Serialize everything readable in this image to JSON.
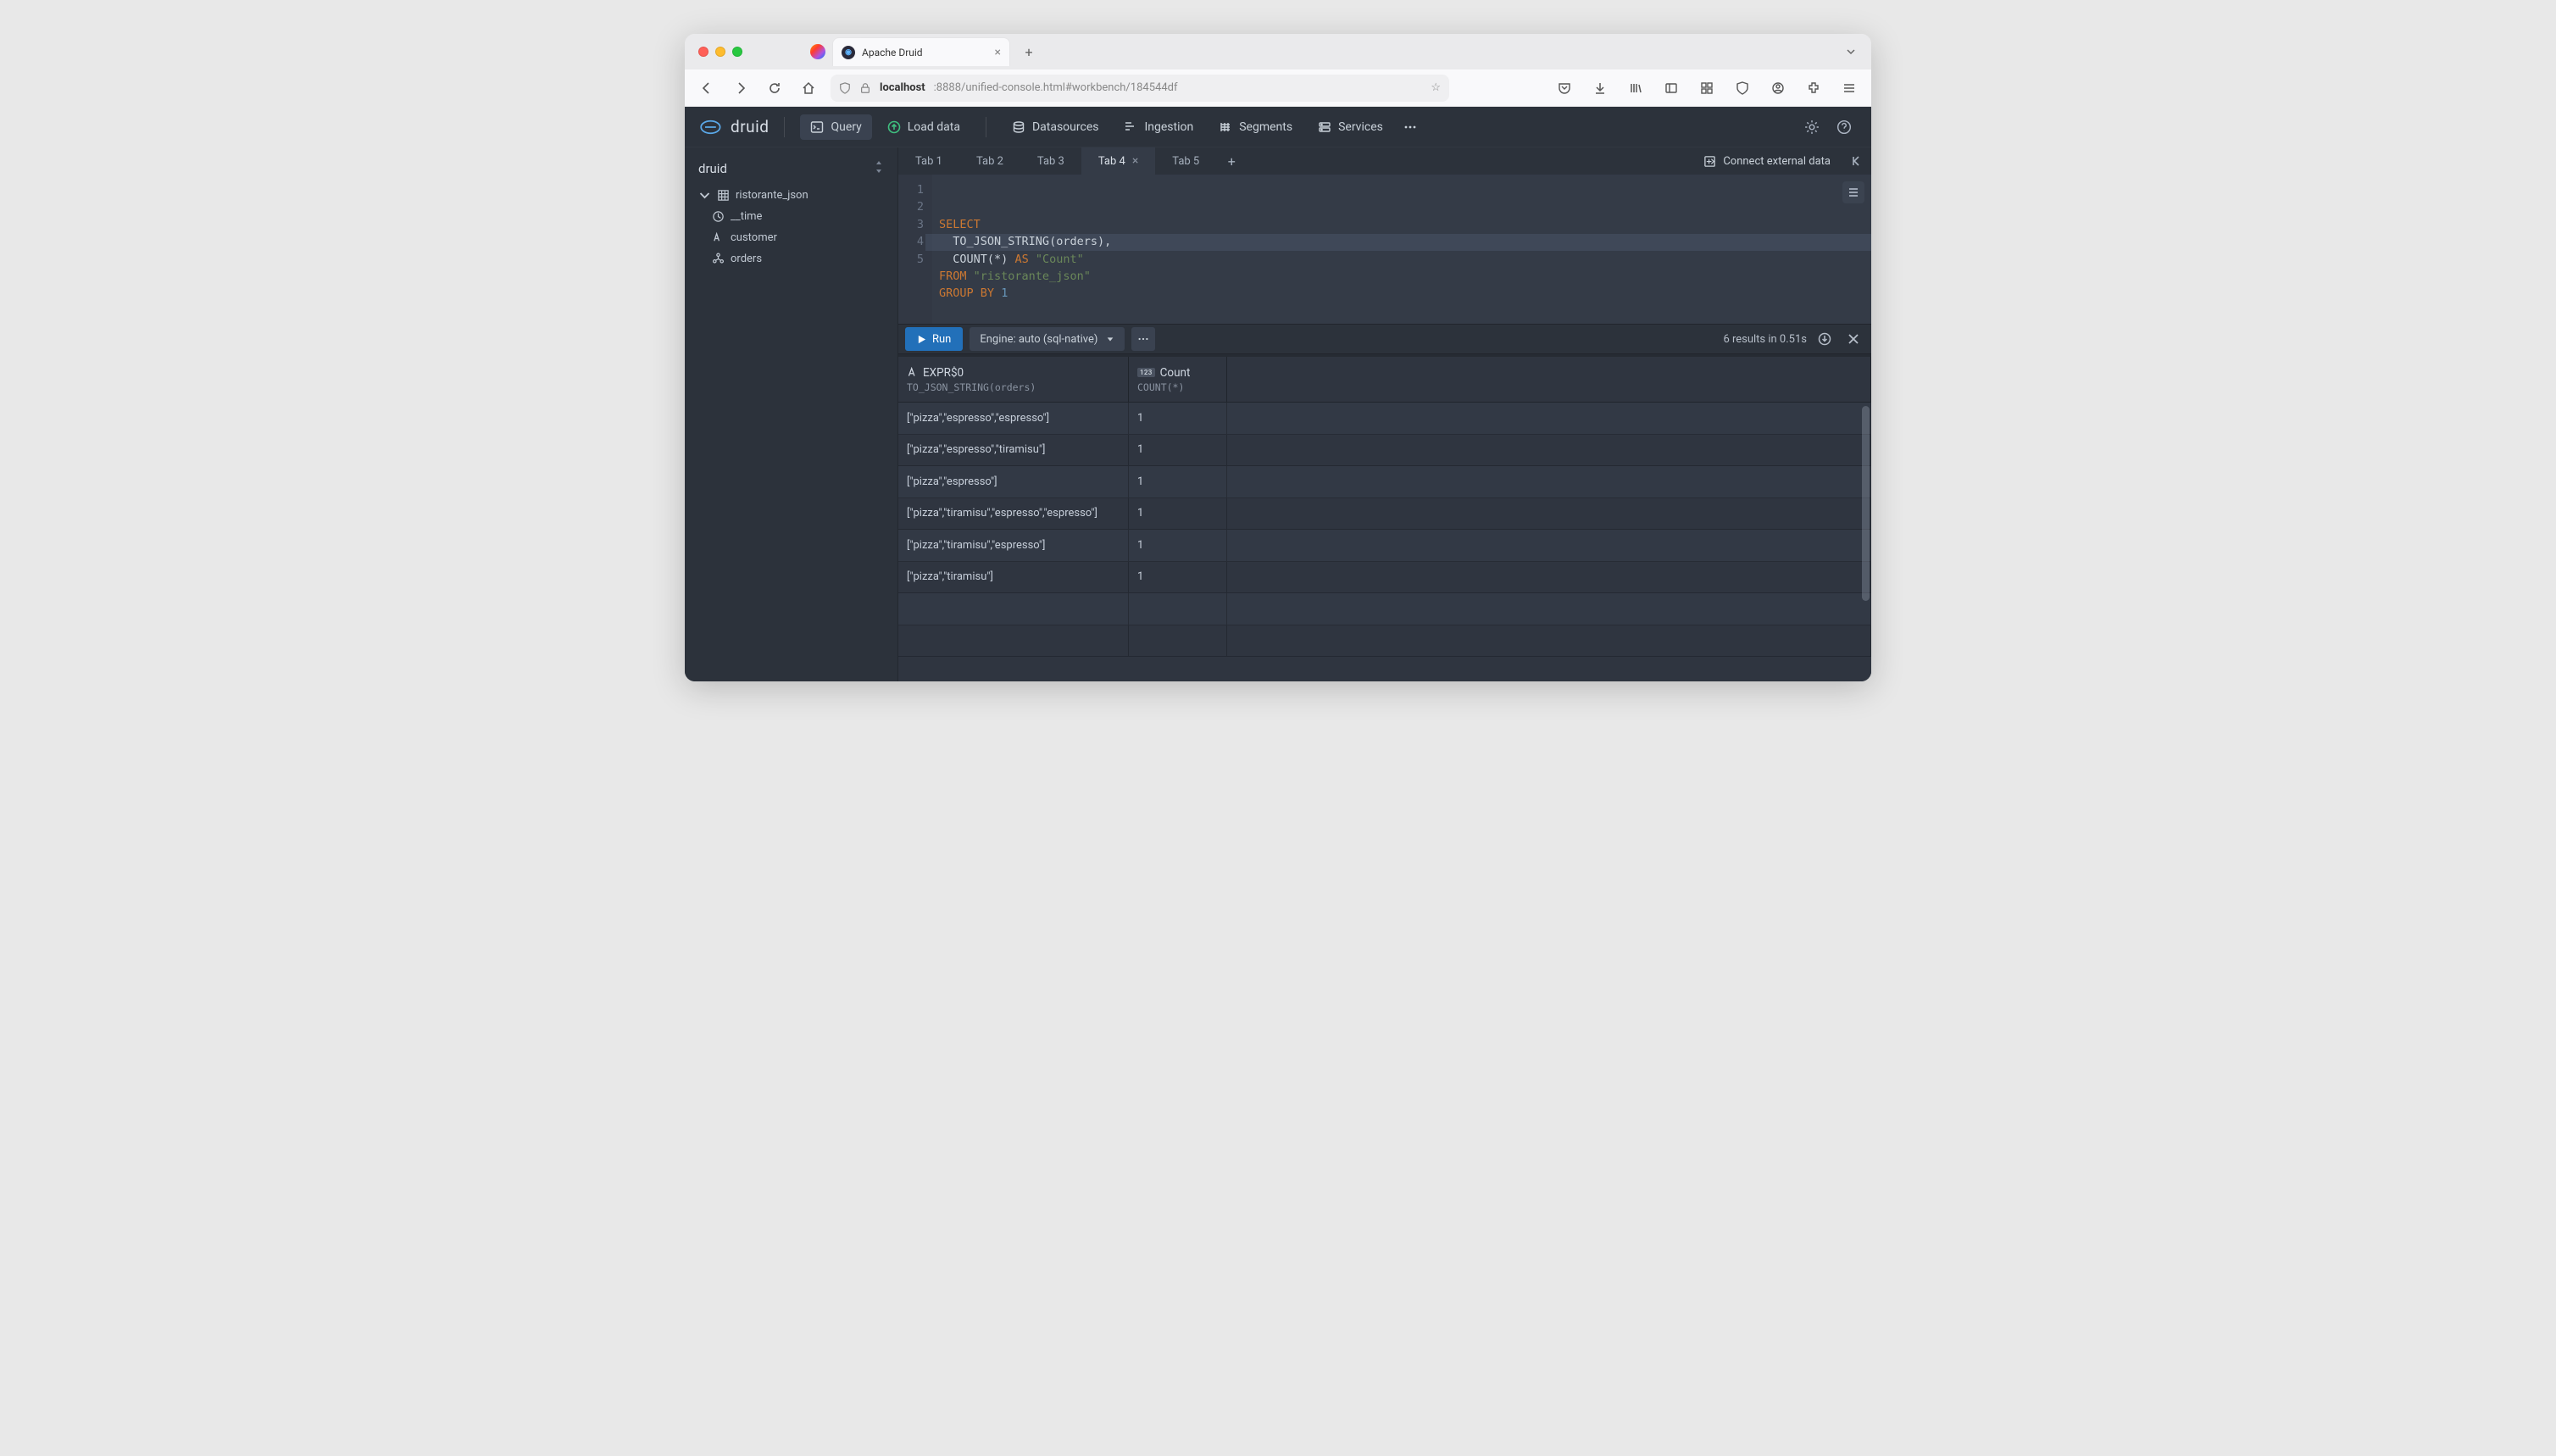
{
  "browser": {
    "tab_title": "Apache Druid",
    "url_host": "localhost",
    "url_path": ":8888/unified-console.html#workbench/184544df"
  },
  "header": {
    "brand": "druid",
    "nav": {
      "query": "Query",
      "load_data": "Load data",
      "datasources": "Datasources",
      "ingestion": "Ingestion",
      "segments": "Segments",
      "services": "Services"
    }
  },
  "sidebar": {
    "title": "druid",
    "datasource": "ristorante_json",
    "columns": {
      "time": "__time",
      "customer": "customer",
      "orders": "orders"
    }
  },
  "tabs": {
    "items": [
      "Tab 1",
      "Tab 2",
      "Tab 3",
      "Tab 4",
      "Tab 5"
    ],
    "active_index": 3,
    "connect_external": "Connect external data"
  },
  "editor": {
    "lines": [
      "1",
      "2",
      "3",
      "4",
      "5"
    ],
    "t": {
      "select": "SELECT",
      "to_json": "TO_JSON_STRING",
      "orders_arg": "(orders),",
      "count": "COUNT",
      "count_arg": "(*)",
      "as": "AS",
      "count_alias": "\"Count\"",
      "from": "FROM",
      "table": "\"ristorante_json\"",
      "group": "GROUP",
      "by": "BY",
      "one": "1"
    }
  },
  "runbar": {
    "run": "Run",
    "engine": "Engine: auto (sql-native)",
    "status": "6 results in 0.51s"
  },
  "results": {
    "col1": {
      "name": "EXPR$0",
      "sub": "TO_JSON_STRING(orders)",
      "type": "A"
    },
    "col2": {
      "name": "Count",
      "sub": "COUNT(*)",
      "type": "123"
    },
    "rows": [
      {
        "expr": "[\"pizza\",\"espresso\",\"espresso\"]",
        "count": "1"
      },
      {
        "expr": "[\"pizza\",\"espresso\",\"tiramisu\"]",
        "count": "1"
      },
      {
        "expr": "[\"pizza\",\"espresso\"]",
        "count": "1"
      },
      {
        "expr": "[\"pizza\",\"tiramisu\",\"espresso\",\"espresso\"]",
        "count": "1"
      },
      {
        "expr": "[\"pizza\",\"tiramisu\",\"espresso\"]",
        "count": "1"
      },
      {
        "expr": "[\"pizza\",\"tiramisu\"]",
        "count": "1"
      }
    ]
  }
}
